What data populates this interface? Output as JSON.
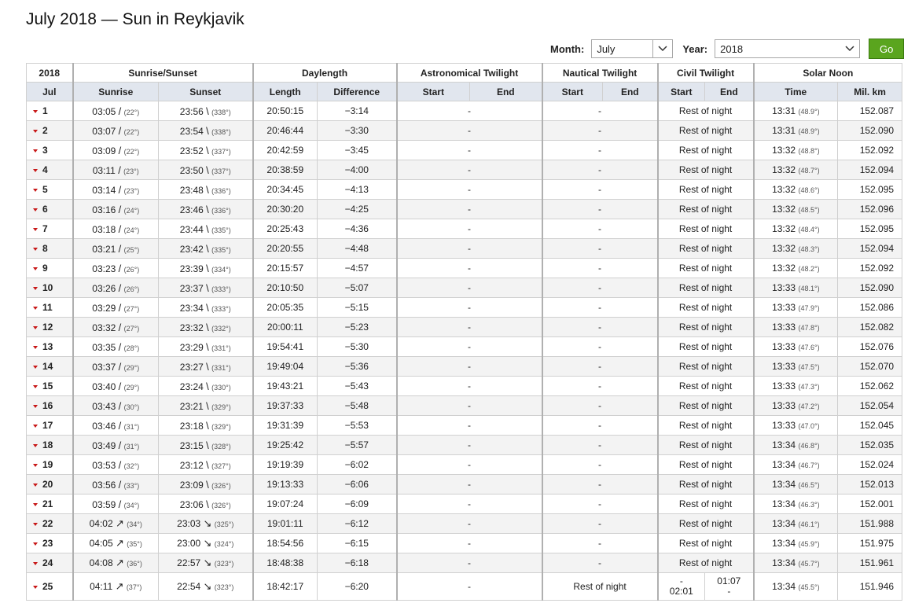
{
  "page": {
    "title": "July 2018 — Sun in Reykjavik"
  },
  "controls": {
    "month_label": "Month:",
    "month_value": "July",
    "year_label": "Year:",
    "year_value": "2018",
    "go_label": "Go"
  },
  "table": {
    "header_groups": {
      "year": "2018",
      "sunrise_sunset": "Sunrise/Sunset",
      "daylength": "Daylength",
      "astronomical": "Astronomical Twilight",
      "nautical": "Nautical Twilight",
      "civil": "Civil Twilight",
      "solar_noon": "Solar Noon"
    },
    "columns": {
      "month": "Jul",
      "sunrise": "Sunrise",
      "sunset": "Sunset",
      "length": "Length",
      "difference": "Difference",
      "astro_start": "Start",
      "astro_end": "End",
      "naut_start": "Start",
      "naut_end": "End",
      "civil_start": "Start",
      "civil_end": "End",
      "noon_time": "Time",
      "distance": "Mil. km"
    },
    "rows": [
      {
        "day": "1",
        "sunrise": "03:05",
        "sunrise_deg": "(22°)",
        "sunset": "23:56",
        "sunset_deg": "(338°)",
        "length": "20:50:15",
        "diff": "−3:14",
        "astro": "-",
        "naut": "-",
        "civil": "Rest of night",
        "noon": "13:31",
        "noon_deg": "(48.9°)",
        "dist": "152.087"
      },
      {
        "day": "2",
        "sunrise": "03:07",
        "sunrise_deg": "(22°)",
        "sunset": "23:54",
        "sunset_deg": "(338°)",
        "length": "20:46:44",
        "diff": "−3:30",
        "astro": "-",
        "naut": "-",
        "civil": "Rest of night",
        "noon": "13:31",
        "noon_deg": "(48.9°)",
        "dist": "152.090"
      },
      {
        "day": "3",
        "sunrise": "03:09",
        "sunrise_deg": "(22°)",
        "sunset": "23:52",
        "sunset_deg": "(337°)",
        "length": "20:42:59",
        "diff": "−3:45",
        "astro": "-",
        "naut": "-",
        "civil": "Rest of night",
        "noon": "13:32",
        "noon_deg": "(48.8°)",
        "dist": "152.092"
      },
      {
        "day": "4",
        "sunrise": "03:11",
        "sunrise_deg": "(23°)",
        "sunset": "23:50",
        "sunset_deg": "(337°)",
        "length": "20:38:59",
        "diff": "−4:00",
        "astro": "-",
        "naut": "-",
        "civil": "Rest of night",
        "noon": "13:32",
        "noon_deg": "(48.7°)",
        "dist": "152.094"
      },
      {
        "day": "5",
        "sunrise": "03:14",
        "sunrise_deg": "(23°)",
        "sunset": "23:48",
        "sunset_deg": "(336°)",
        "length": "20:34:45",
        "diff": "−4:13",
        "astro": "-",
        "naut": "-",
        "civil": "Rest of night",
        "noon": "13:32",
        "noon_deg": "(48.6°)",
        "dist": "152.095"
      },
      {
        "day": "6",
        "sunrise": "03:16",
        "sunrise_deg": "(24°)",
        "sunset": "23:46",
        "sunset_deg": "(336°)",
        "length": "20:30:20",
        "diff": "−4:25",
        "astro": "-",
        "naut": "-",
        "civil": "Rest of night",
        "noon": "13:32",
        "noon_deg": "(48.5°)",
        "dist": "152.096"
      },
      {
        "day": "7",
        "sunrise": "03:18",
        "sunrise_deg": "(24°)",
        "sunset": "23:44",
        "sunset_deg": "(335°)",
        "length": "20:25:43",
        "diff": "−4:36",
        "astro": "-",
        "naut": "-",
        "civil": "Rest of night",
        "noon": "13:32",
        "noon_deg": "(48.4°)",
        "dist": "152.095"
      },
      {
        "day": "8",
        "sunrise": "03:21",
        "sunrise_deg": "(25°)",
        "sunset": "23:42",
        "sunset_deg": "(335°)",
        "length": "20:20:55",
        "diff": "−4:48",
        "astro": "-",
        "naut": "-",
        "civil": "Rest of night",
        "noon": "13:32",
        "noon_deg": "(48.3°)",
        "dist": "152.094"
      },
      {
        "day": "9",
        "sunrise": "03:23",
        "sunrise_deg": "(26°)",
        "sunset": "23:39",
        "sunset_deg": "(334°)",
        "length": "20:15:57",
        "diff": "−4:57",
        "astro": "-",
        "naut": "-",
        "civil": "Rest of night",
        "noon": "13:32",
        "noon_deg": "(48.2°)",
        "dist": "152.092"
      },
      {
        "day": "10",
        "sunrise": "03:26",
        "sunrise_deg": "(26°)",
        "sunset": "23:37",
        "sunset_deg": "(333°)",
        "length": "20:10:50",
        "diff": "−5:07",
        "astro": "-",
        "naut": "-",
        "civil": "Rest of night",
        "noon": "13:33",
        "noon_deg": "(48.1°)",
        "dist": "152.090"
      },
      {
        "day": "11",
        "sunrise": "03:29",
        "sunrise_deg": "(27°)",
        "sunset": "23:34",
        "sunset_deg": "(333°)",
        "length": "20:05:35",
        "diff": "−5:15",
        "astro": "-",
        "naut": "-",
        "civil": "Rest of night",
        "noon": "13:33",
        "noon_deg": "(47.9°)",
        "dist": "152.086"
      },
      {
        "day": "12",
        "sunrise": "03:32",
        "sunrise_deg": "(27°)",
        "sunset": "23:32",
        "sunset_deg": "(332°)",
        "length": "20:00:11",
        "diff": "−5:23",
        "astro": "-",
        "naut": "-",
        "civil": "Rest of night",
        "noon": "13:33",
        "noon_deg": "(47.8°)",
        "dist": "152.082"
      },
      {
        "day": "13",
        "sunrise": "03:35",
        "sunrise_deg": "(28°)",
        "sunset": "23:29",
        "sunset_deg": "(331°)",
        "length": "19:54:41",
        "diff": "−5:30",
        "astro": "-",
        "naut": "-",
        "civil": "Rest of night",
        "noon": "13:33",
        "noon_deg": "(47.6°)",
        "dist": "152.076"
      },
      {
        "day": "14",
        "sunrise": "03:37",
        "sunrise_deg": "(29°)",
        "sunset": "23:27",
        "sunset_deg": "(331°)",
        "length": "19:49:04",
        "diff": "−5:36",
        "astro": "-",
        "naut": "-",
        "civil": "Rest of night",
        "noon": "13:33",
        "noon_deg": "(47.5°)",
        "dist": "152.070"
      },
      {
        "day": "15",
        "sunrise": "03:40",
        "sunrise_deg": "(29°)",
        "sunset": "23:24",
        "sunset_deg": "(330°)",
        "length": "19:43:21",
        "diff": "−5:43",
        "astro": "-",
        "naut": "-",
        "civil": "Rest of night",
        "noon": "13:33",
        "noon_deg": "(47.3°)",
        "dist": "152.062"
      },
      {
        "day": "16",
        "sunrise": "03:43",
        "sunrise_deg": "(30°)",
        "sunset": "23:21",
        "sunset_deg": "(329°)",
        "length": "19:37:33",
        "diff": "−5:48",
        "astro": "-",
        "naut": "-",
        "civil": "Rest of night",
        "noon": "13:33",
        "noon_deg": "(47.2°)",
        "dist": "152.054"
      },
      {
        "day": "17",
        "sunrise": "03:46",
        "sunrise_deg": "(31°)",
        "sunset": "23:18",
        "sunset_deg": "(329°)",
        "length": "19:31:39",
        "diff": "−5:53",
        "astro": "-",
        "naut": "-",
        "civil": "Rest of night",
        "noon": "13:33",
        "noon_deg": "(47.0°)",
        "dist": "152.045"
      },
      {
        "day": "18",
        "sunrise": "03:49",
        "sunrise_deg": "(31°)",
        "sunset": "23:15",
        "sunset_deg": "(328°)",
        "length": "19:25:42",
        "diff": "−5:57",
        "astro": "-",
        "naut": "-",
        "civil": "Rest of night",
        "noon": "13:34",
        "noon_deg": "(46.8°)",
        "dist": "152.035"
      },
      {
        "day": "19",
        "sunrise": "03:53",
        "sunrise_deg": "(32°)",
        "sunset": "23:12",
        "sunset_deg": "(327°)",
        "length": "19:19:39",
        "diff": "−6:02",
        "astro": "-",
        "naut": "-",
        "civil": "Rest of night",
        "noon": "13:34",
        "noon_deg": "(46.7°)",
        "dist": "152.024"
      },
      {
        "day": "20",
        "sunrise": "03:56",
        "sunrise_deg": "(33°)",
        "sunset": "23:09",
        "sunset_deg": "(326°)",
        "length": "19:13:33",
        "diff": "−6:06",
        "astro": "-",
        "naut": "-",
        "civil": "Rest of night",
        "noon": "13:34",
        "noon_deg": "(46.5°)",
        "dist": "152.013"
      },
      {
        "day": "21",
        "sunrise": "03:59",
        "sunrise_deg": "(34°)",
        "sunset": "23:06",
        "sunset_deg": "(326°)",
        "length": "19:07:24",
        "diff": "−6:09",
        "astro": "-",
        "naut": "-",
        "civil": "Rest of night",
        "noon": "13:34",
        "noon_deg": "(46.3°)",
        "dist": "152.001"
      },
      {
        "day": "22",
        "sunrise": "04:02",
        "sunrise_deg": "(34°)",
        "sunset": "23:03",
        "sunset_deg": "(325°)",
        "length": "19:01:11",
        "diff": "−6:12",
        "astro": "-",
        "naut": "-",
        "civil": "Rest of night",
        "noon": "13:34",
        "noon_deg": "(46.1°)",
        "dist": "151.988"
      },
      {
        "day": "23",
        "sunrise": "04:05",
        "sunrise_deg": "(35°)",
        "sunset": "23:00",
        "sunset_deg": "(324°)",
        "length": "18:54:56",
        "diff": "−6:15",
        "astro": "-",
        "naut": "-",
        "civil": "Rest of night",
        "noon": "13:34",
        "noon_deg": "(45.9°)",
        "dist": "151.975"
      },
      {
        "day": "24",
        "sunrise": "04:08",
        "sunrise_deg": "(36°)",
        "sunset": "22:57",
        "sunset_deg": "(323°)",
        "length": "18:48:38",
        "diff": "−6:18",
        "astro": "-",
        "naut": "-",
        "civil": "Rest of night",
        "noon": "13:34",
        "noon_deg": "(45.7°)",
        "dist": "151.961"
      }
    ],
    "last_row": {
      "day": "25",
      "sunrise": "04:11",
      "sunrise_deg": "(37°)",
      "sunset": "22:54",
      "sunset_deg": "(323°)",
      "length": "18:42:17",
      "diff": "−6:20",
      "astro": "-",
      "naut": "Rest of night",
      "civil_start_top": "-",
      "civil_start_bottom": "02:01",
      "civil_end_top": "01:07",
      "civil_end_bottom": "-",
      "noon": "13:34",
      "noon_deg": "(45.5°)",
      "dist": "151.946"
    }
  },
  "icons": {
    "row_expand": "caret-down-icon",
    "sunrise_dir": "arrow-up-right-icon",
    "sunset_dir": "arrow-down-right-icon",
    "select": "chevron-down-icon"
  },
  "colors": {
    "accent_go": "#5aa51e",
    "header_bg": "#e1e6ee",
    "caret": "#c81818"
  }
}
